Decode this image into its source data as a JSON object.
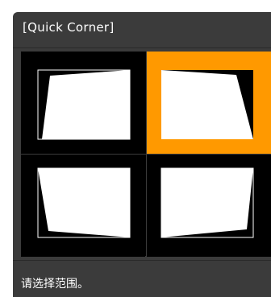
{
  "panel": {
    "title": "[Quick Corner]",
    "status": "请选择范围。"
  },
  "colors": {
    "panel_bg": "#3b3b3b",
    "selected_bg": "#ff9900",
    "cell_bg": "#000000",
    "shape_fill": "#ffffff"
  },
  "grid": {
    "selected_index": 1,
    "cells": [
      {
        "id": "top-left",
        "icon": "keystone-top-left-icon"
      },
      {
        "id": "top-right",
        "icon": "keystone-top-right-icon"
      },
      {
        "id": "bottom-left",
        "icon": "keystone-bottom-left-icon"
      },
      {
        "id": "bottom-right",
        "icon": "keystone-bottom-right-icon"
      }
    ]
  }
}
